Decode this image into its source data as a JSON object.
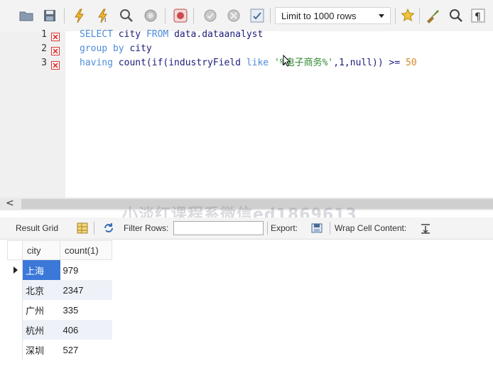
{
  "toolbar": {
    "limit_label": "Limit to 1000 rows",
    "icons": [
      "folder-open-icon",
      "save-icon",
      "execute-icon",
      "execute-current-icon",
      "explain-icon",
      "stop-icon",
      "toggle-continue-icon",
      "commit-icon",
      "rollback-icon",
      "autocommit-icon",
      "beautify-icon",
      "find-icon",
      "invisible-chars-icon",
      "wrap-icon"
    ]
  },
  "editor": {
    "line_numbers": [
      "1",
      "2",
      "3"
    ],
    "lines": [
      {
        "kw1": "SELECT",
        "id1": " city ",
        "kw2": "FROM",
        "id2": " data.dataanalyst"
      },
      {
        "kw1": "group by",
        "id1": " city"
      },
      {
        "kw1": "having",
        "id1": " count(if(industryField ",
        "kw2": "like",
        "id2": " ",
        "str": "'%电子商务%'",
        "id3": ",1,null)) >= ",
        "num": "50"
      }
    ]
  },
  "watermark": "小淡红课程系微信ed1869613",
  "results_toolbar": {
    "result_grid_label": "Result Grid",
    "filter_rows_label": "Filter Rows:",
    "filter_value": "",
    "export_label": "Export:",
    "wrap_label": "Wrap Cell Content:"
  },
  "grid": {
    "columns": [
      "city",
      "count(1)"
    ],
    "rows": [
      {
        "city": "上海",
        "count": "979"
      },
      {
        "city": "北京",
        "count": "2347"
      },
      {
        "city": "广州",
        "count": "335"
      },
      {
        "city": "杭州",
        "count": "406"
      },
      {
        "city": "深圳",
        "count": "527"
      }
    ]
  },
  "colors": {
    "keyword": "#4d8cd8",
    "string": "#2f8a2f",
    "number": "#d48a2a",
    "selection": "#3c78d8"
  }
}
